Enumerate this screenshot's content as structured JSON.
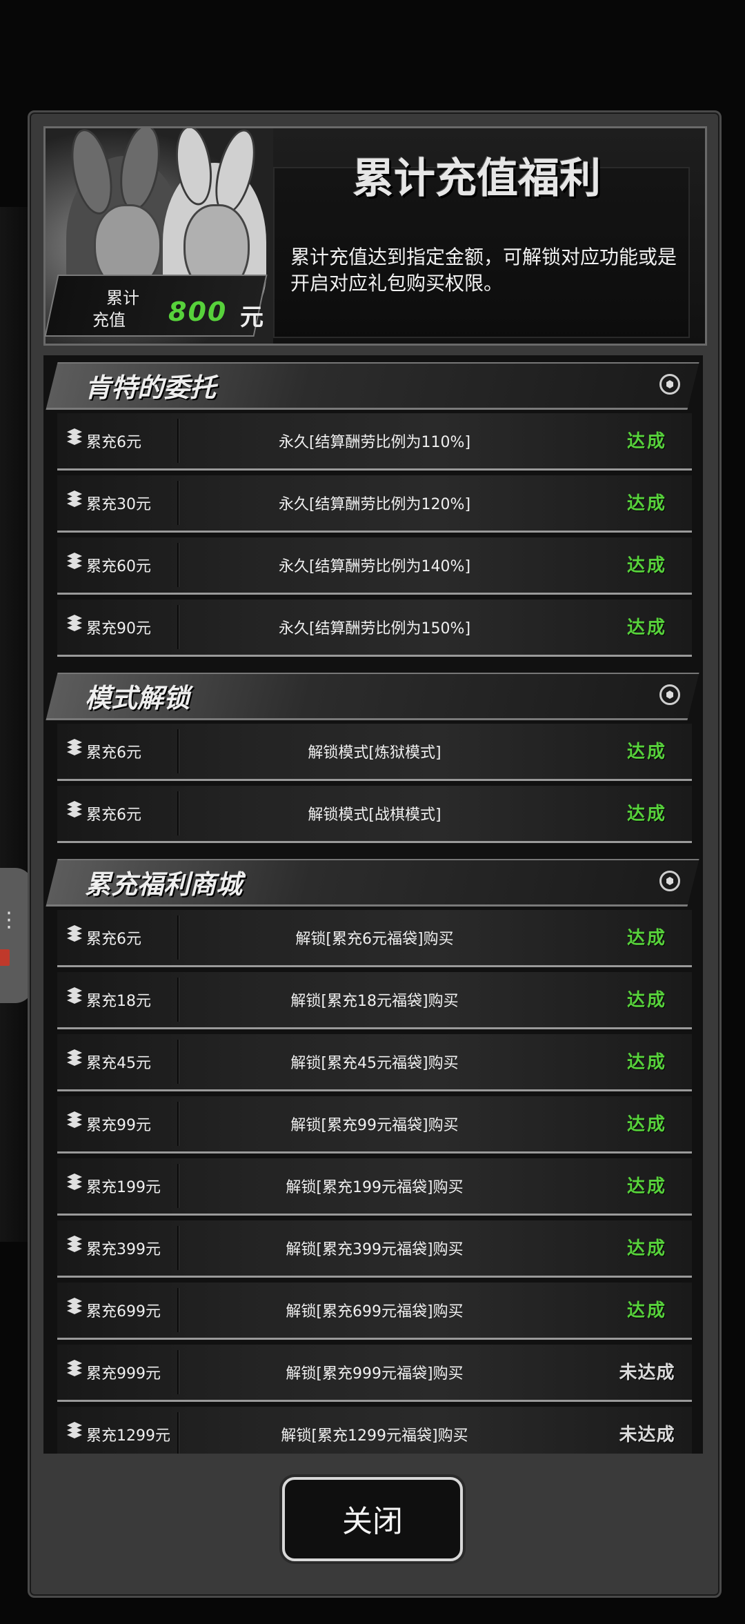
{
  "header": {
    "title": "累计充值福利",
    "description": "累计充值达到指定金额，可解锁对应功能或是开启对应礼包购买权限。",
    "badge_label_line1": "累计",
    "badge_label_line2": "充值",
    "badge_amount": "800",
    "badge_unit": "元"
  },
  "sections": [
    {
      "title": "肯特的委托",
      "rows": [
        {
          "amount": "累充6元",
          "reward": "永久[结算酬劳比例为110%]",
          "status": "达成"
        },
        {
          "amount": "累充30元",
          "reward": "永久[结算酬劳比例为120%]",
          "status": "达成"
        },
        {
          "amount": "累充60元",
          "reward": "永久[结算酬劳比例为140%]",
          "status": "达成"
        },
        {
          "amount": "累充90元",
          "reward": "永久[结算酬劳比例为150%]",
          "status": "达成"
        }
      ]
    },
    {
      "title": "模式解锁",
      "rows": [
        {
          "amount": "累充6元",
          "reward": "解锁模式[炼狱模式]",
          "status": "达成"
        },
        {
          "amount": "累充6元",
          "reward": "解锁模式[战棋模式]",
          "status": "达成"
        }
      ]
    },
    {
      "title": "累充福利商城",
      "rows": [
        {
          "amount": "累充6元",
          "reward": "解锁[累充6元福袋]购买",
          "status": "达成"
        },
        {
          "amount": "累充18元",
          "reward": "解锁[累充18元福袋]购买",
          "status": "达成"
        },
        {
          "amount": "累充45元",
          "reward": "解锁[累充45元福袋]购买",
          "status": "达成"
        },
        {
          "amount": "累充99元",
          "reward": "解锁[累充99元福袋]购买",
          "status": "达成"
        },
        {
          "amount": "累充199元",
          "reward": "解锁[累充199元福袋]购买",
          "status": "达成"
        },
        {
          "amount": "累充399元",
          "reward": "解锁[累充399元福袋]购买",
          "status": "达成"
        },
        {
          "amount": "累充699元",
          "reward": "解锁[累充699元福袋]购买",
          "status": "达成"
        },
        {
          "amount": "累充999元",
          "reward": "解锁[累充999元福袋]购买",
          "status": "未达成"
        },
        {
          "amount": "累充1299元",
          "reward": "解锁[累充1299元福袋]购买",
          "status": "未达成"
        }
      ]
    }
  ],
  "close_label": "关闭",
  "colors": {
    "achieved": "#57d13b",
    "pending": "#d9d9d9"
  },
  "icons": {
    "row": "stack-layers-icon",
    "section": "hexagon-badge-icon"
  }
}
